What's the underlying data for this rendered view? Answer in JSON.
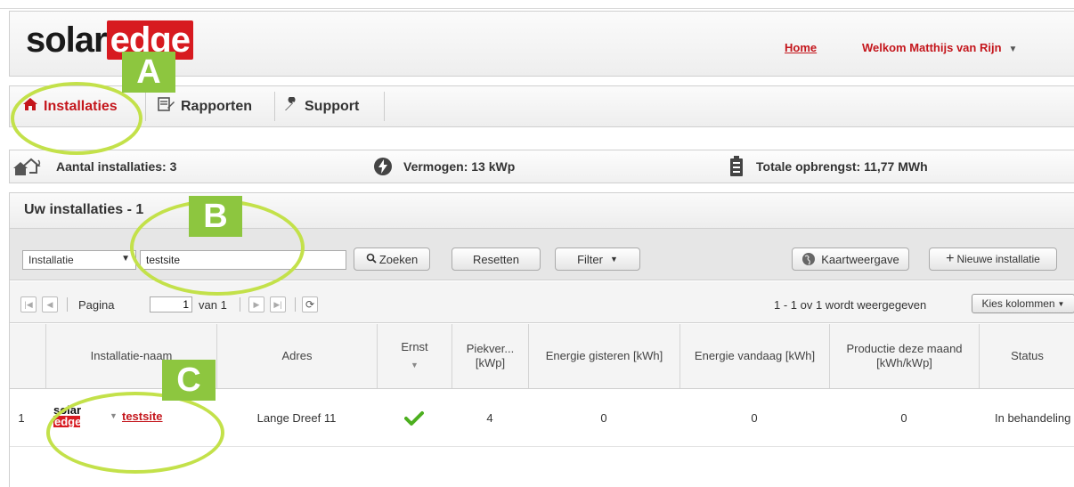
{
  "header": {
    "logo_left": "solar",
    "logo_right": "edge",
    "home_link": "Home",
    "welcome": "Welkom Matthijs van Rijn",
    "welcome_arrow": "▼"
  },
  "nav": {
    "tabs": [
      {
        "label": "Installaties",
        "icon": "home-icon"
      },
      {
        "label": "Rapporten",
        "icon": "report-icon"
      },
      {
        "label": "Support",
        "icon": "wrench-icon"
      }
    ]
  },
  "stats": {
    "installations": "Aantal installaties: 3",
    "power": "Vermogen: 13 kWp",
    "yield": "Totale opbrengst: 11,77 MWh"
  },
  "panel": {
    "title": "Uw installaties - 1"
  },
  "toolbar": {
    "filter_select_value": "Installatie",
    "search_value": "testsite",
    "search_button": "Zoeken",
    "reset_button": "Resetten",
    "filter_button": "Filter",
    "map_button": "Kaartweergave",
    "new_button": "Nieuwe installatie"
  },
  "pager": {
    "page_label": "Pagina",
    "page_value": "1",
    "of_label": "van 1",
    "summary": "1 - 1 ov 1 wordt weergegeven",
    "columns_button": "Kies kolommen"
  },
  "table": {
    "headers": {
      "name": "Installatie-naam",
      "address": "Adres",
      "severity": "Ernst",
      "peak": "Piekver... [kWp]",
      "energy_yesterday": "Energie gisteren [kWh]",
      "energy_today": "Energie vandaag [kWh]",
      "production_month": "Productie deze maand [kWh/kWp]",
      "status": "Status"
    },
    "rows": [
      {
        "index": "1",
        "logo_top": "solar",
        "logo_bottom": "edge",
        "name": "testsite",
        "address": "Lange Dreef 11",
        "peak": "4",
        "energy_yesterday": "0",
        "energy_today": "0",
        "production_month": "0",
        "status": "In behandeling"
      }
    ]
  },
  "annotations": {
    "a": "A",
    "b": "B",
    "c": "C"
  },
  "colors": {
    "brand_red": "#c4161c",
    "annotation_green": "#8dc63f",
    "ring_green": "#c3e14a",
    "check_green": "#4caf1f"
  }
}
